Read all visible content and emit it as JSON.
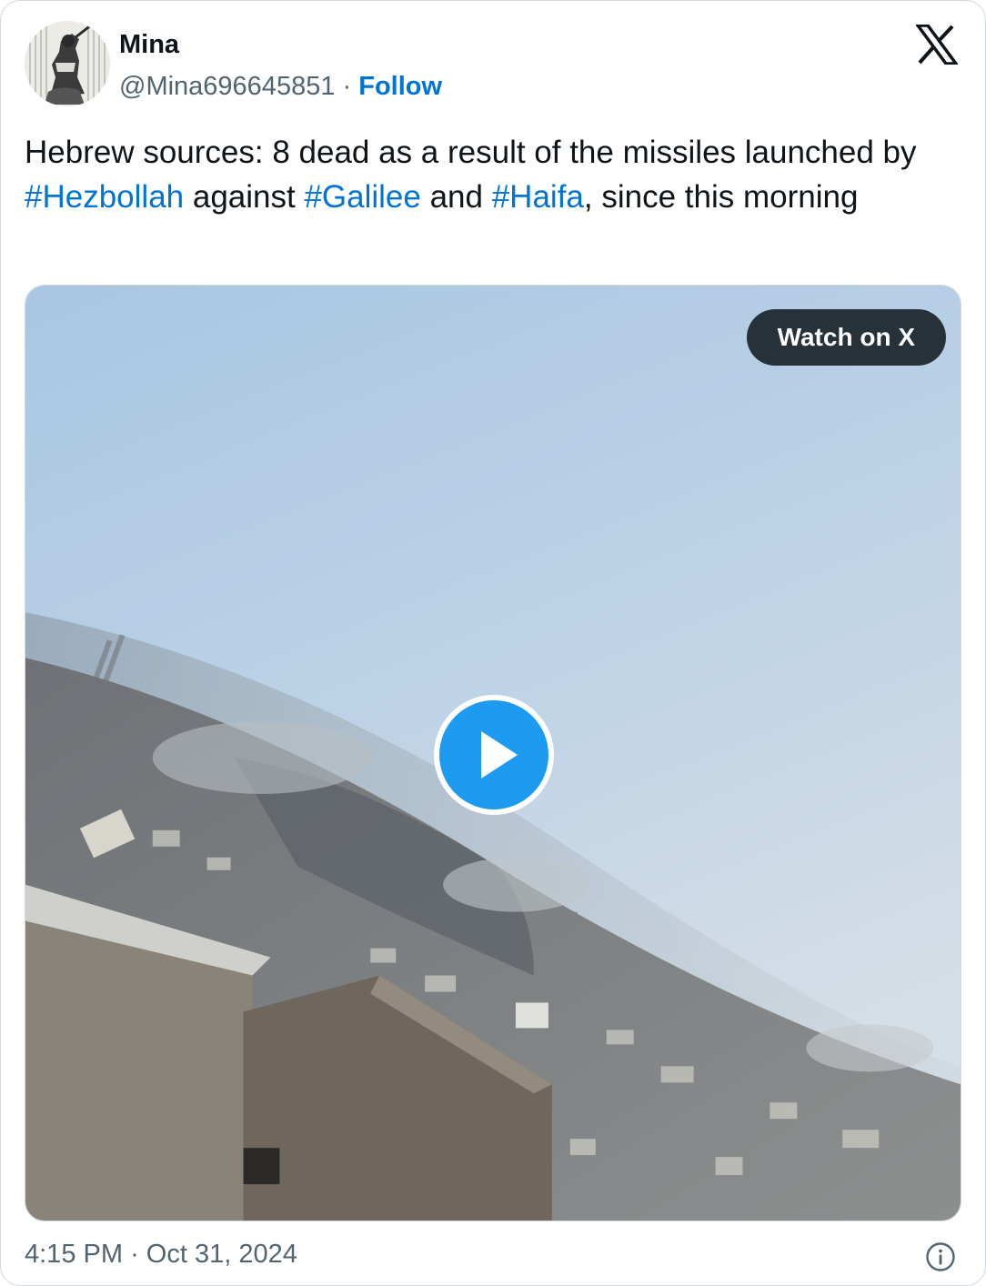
{
  "author": {
    "name": "Mina",
    "handle": "@Mina696645851",
    "separator": "·",
    "follow_label": "Follow"
  },
  "tweet": {
    "parts": [
      {
        "text": "Hebrew sources: 8 dead as a result of the missiles launched by "
      },
      {
        "text": "#Hezbollah",
        "tag": true
      },
      {
        "text": " against "
      },
      {
        "text": "#Galilee",
        "tag": true
      },
      {
        "text": " and "
      },
      {
        "text": "#Haifa",
        "tag": true
      },
      {
        "text": ", since this morning"
      }
    ]
  },
  "media": {
    "watch_label": "Watch on X",
    "play_icon": "play-icon"
  },
  "footer": {
    "time": "4:15 PM",
    "separator": "·",
    "date": "Oct 31, 2024",
    "info_icon": "info-icon"
  },
  "icons": {
    "brand": "x-logo-icon",
    "info": "info-icon",
    "play": "play-icon"
  },
  "colors": {
    "link": "#0074d4",
    "play_button": "#1d9bf0",
    "watch_button": "#27313a",
    "secondary_text": "#536471"
  }
}
